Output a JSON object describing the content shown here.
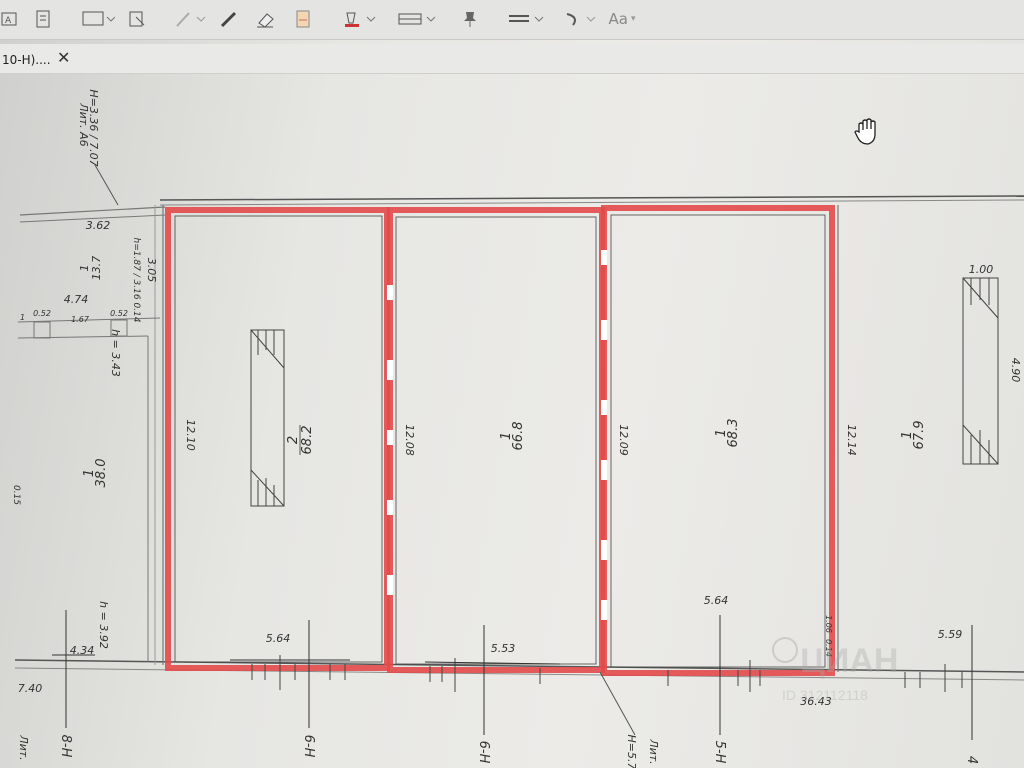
{
  "tab": {
    "title": "10-H)....",
    "close_glyph": "✕"
  },
  "toolbar": {
    "font_button": "Aa"
  },
  "plan": {
    "rooms": [
      {
        "num": "2",
        "area": "68.2",
        "len": "12.10",
        "width": "5.64"
      },
      {
        "num": "1",
        "area": "66.8",
        "len": "12.08",
        "width": "5.53"
      },
      {
        "num": "1",
        "area": "68.3",
        "len": "12.09",
        "width": "5.64"
      },
      {
        "num": "1",
        "area": "67.9",
        "len": "12.14",
        "width": "5.59"
      },
      {
        "num": "1",
        "area": "13.7"
      },
      {
        "num": "1",
        "area": "38.0"
      }
    ],
    "dims": {
      "d362": "3.62",
      "d305": "3.05",
      "d474": "4.74",
      "d052a": "0.52",
      "d167": "1.67",
      "d052b": "0.52",
      "d1": "1",
      "h343": "h = 3.43",
      "h187": "h=1.87 / 3.16 0.14",
      "h392": "h = 3.92",
      "d434": "4.34",
      "d740": "7.40",
      "d3643": "36.43",
      "d100": "1.00",
      "d490": "4.90",
      "d106": "1.06",
      "d014": "0.14",
      "d015": "0.15"
    },
    "lit_top": "Лит. А6",
    "h_top": "Н=3.36 / 7.07",
    "lit_bottom": "Лит.",
    "h_bottom": "Н=5.7",
    "lit_left": "Лит.",
    "axes": [
      "8-Н",
      "6-Н",
      "6-Н",
      "5-Н",
      "4"
    ],
    "watermark": "ЦИАН",
    "watermark_id": "ID 312112118"
  }
}
